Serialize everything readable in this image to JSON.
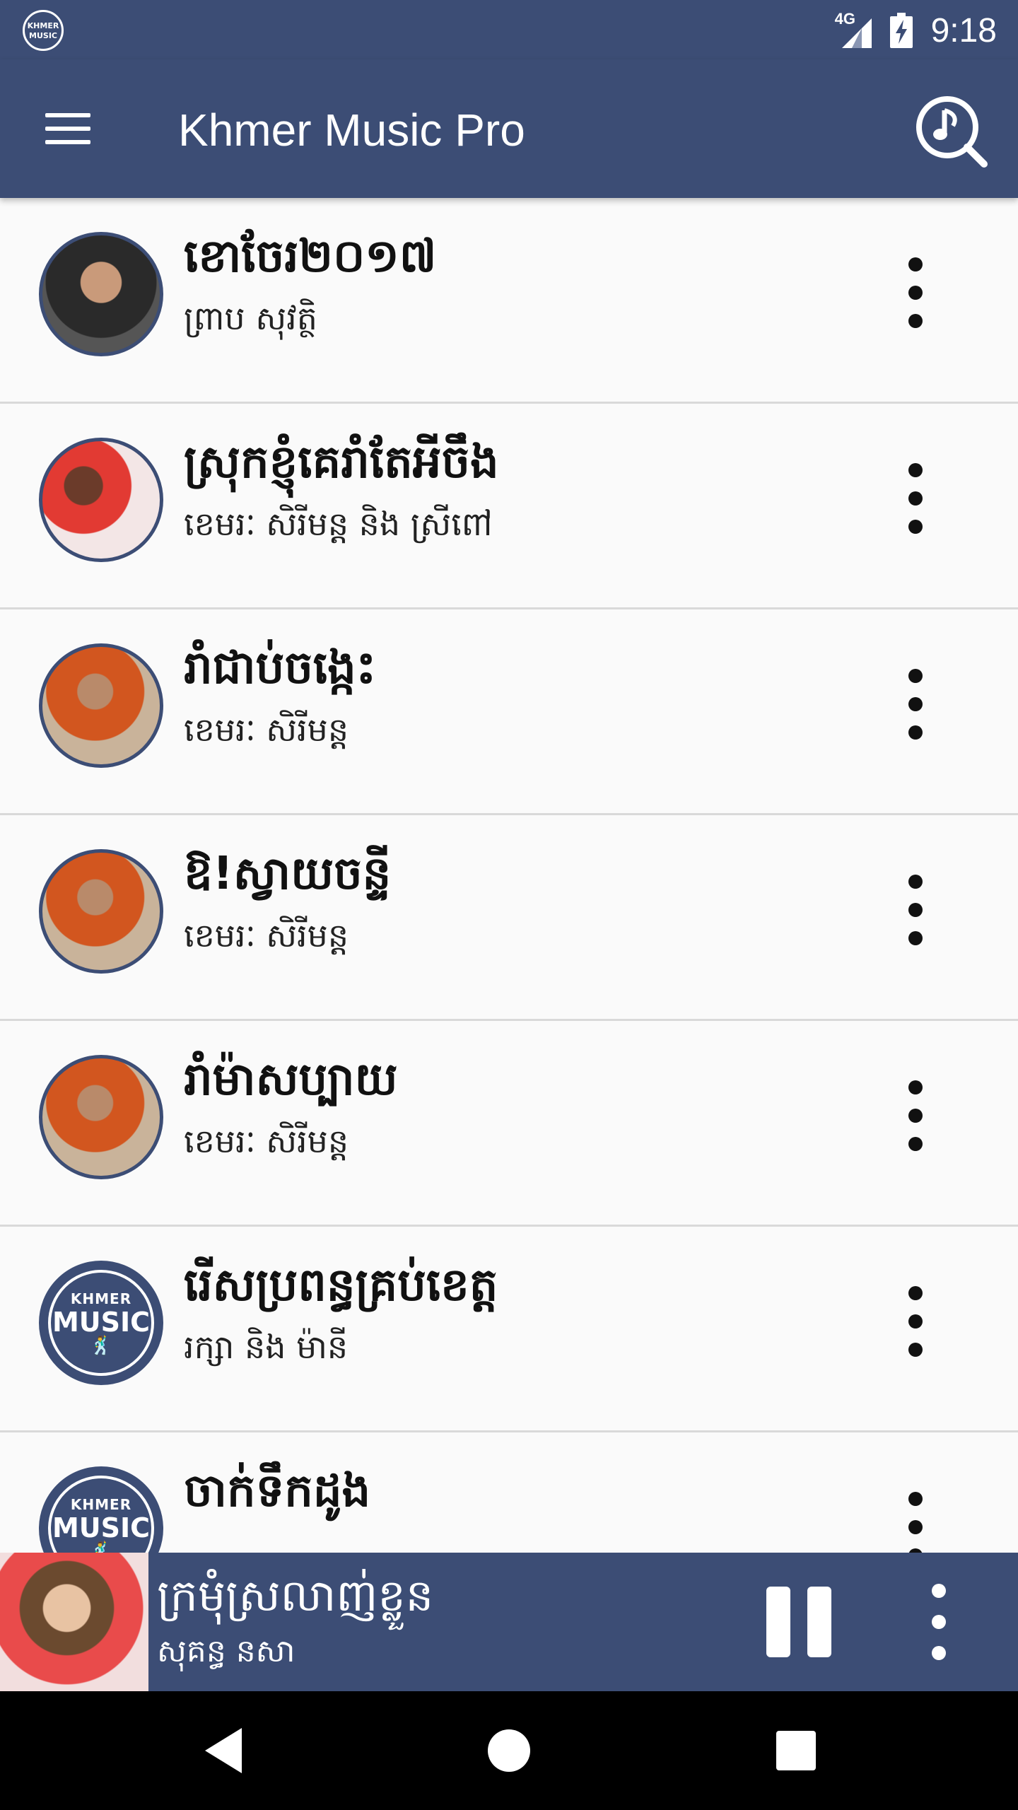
{
  "status_bar": {
    "network": "4G",
    "time": "9:18",
    "logo_text_top": "KHMER",
    "logo_text_main": "MUSIC"
  },
  "app_bar": {
    "title": "Khmer Music Pro",
    "menu_icon": "hamburger-menu-icon",
    "search_icon": "music-search-icon"
  },
  "songs": [
    {
      "title": "ខោចែរ២០១៧",
      "artist": "ព្រាប សុវត្ថិ"
    },
    {
      "title": "ស្រុកខ្ញុំគេរាំតែអីចឹង",
      "artist": "ខេមរៈ សិរីមន្ត និង ស្រីពៅ"
    },
    {
      "title": "រាំជាប់ចង្កេះ",
      "artist": "ខេមរៈ សិរីមន្ត"
    },
    {
      "title": "ឱ!ស្វាយចន្ទី",
      "artist": "ខេមរៈ សិរីមន្ត"
    },
    {
      "title": "រាំម៉ាសប្បាយ",
      "artist": "ខេមរៈ សិរីមន្ត"
    },
    {
      "title": "រើសប្រពន្ធគ្រប់ខេត្ត",
      "artist": "រក្សា និង ម៉ានី",
      "logo_top": "KHMER",
      "logo_main": "MUSIC"
    },
    {
      "title": "ចាក់ទឹកដូង",
      "artist": "",
      "logo_top": "KHMER",
      "logo_main": "MUSIC"
    }
  ],
  "now_playing": {
    "title": "ក្រមុំស្រលាញ់ខ្លួន",
    "artist": "សុគន្ធ នសា",
    "state": "playing"
  },
  "colors": {
    "primary": "#3c4d75",
    "list_bg": "#fafafa",
    "divider": "#d9d9d9",
    "nav_bg": "#000000"
  }
}
